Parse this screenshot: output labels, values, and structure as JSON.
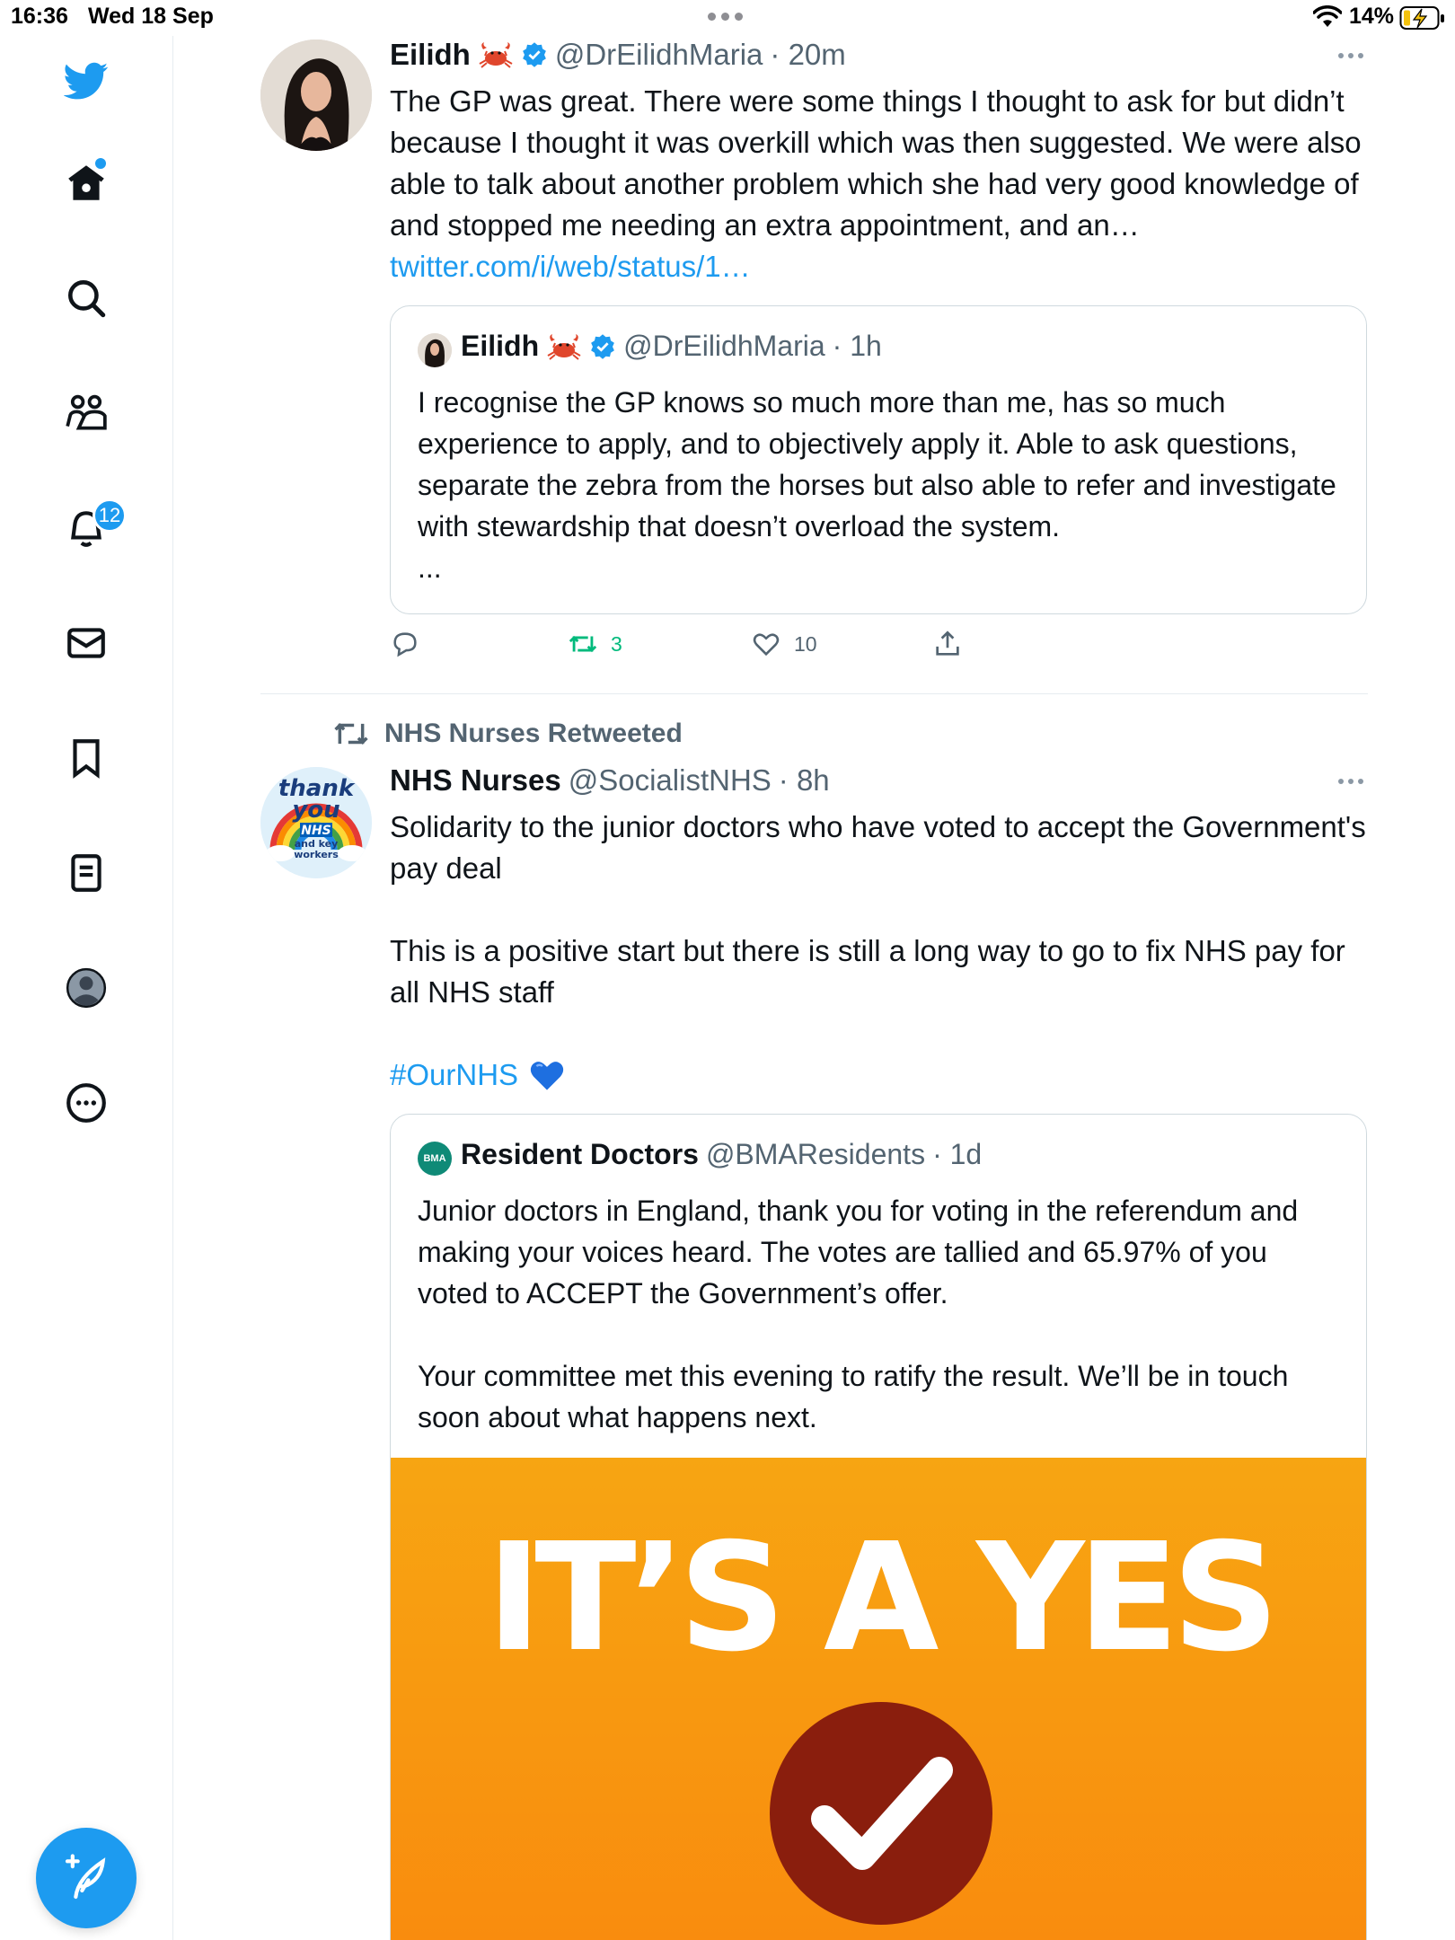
{
  "status_bar": {
    "time": "16:36",
    "date": "Wed 18 Sep",
    "battery_percent": "14%"
  },
  "sidebar": {
    "notification_count": "12",
    "items": [
      "twitter-logo",
      "home",
      "search",
      "communities",
      "notifications",
      "messages",
      "bookmarks",
      "lists",
      "profile",
      "more"
    ]
  },
  "tweet1": {
    "name": "Eilidh",
    "handle": "@DrEilidhMaria",
    "time": "· 20m",
    "text": "The GP was great. There were some things I thought to ask for but didn’t because I thought it was overkill which was then suggested. We were also able to talk about another problem which she had very good knowledge of and stopped me needing an extra appointment, and an…",
    "link": "twitter.com/i/web/status/1…",
    "quote": {
      "name": "Eilidh",
      "handle": "@DrEilidhMaria",
      "time": "· 1h",
      "text": "I recognise the GP knows so much more than me, has so much experience to apply, and to objectively apply it. Able to ask questions, separate the zebra from the horses but also able to refer and investigate with stewardship that doesn’t overload the system.",
      "ellipsis": "..."
    },
    "retweets": "3",
    "likes": "10"
  },
  "tweet2": {
    "retweeted_by": "NHS Nurses Retweeted",
    "name": "NHS Nurses",
    "handle": "@SocialistNHS",
    "time": "· 8h",
    "paragraph1": "Solidarity to the junior doctors who have voted to accept the Government's pay deal",
    "paragraph2": "This is a positive start but there is still a long way to go to fix NHS pay for all NHS staff",
    "hashtag": "#OurNHS",
    "avatar_text": {
      "line1": "thank",
      "line2": "you",
      "line3": "NHS",
      "line4": "and key",
      "line5": "workers"
    },
    "quote": {
      "name": "Resident Doctors",
      "handle": "@BMAResidents",
      "time": "· 1d",
      "avatar_text": "BMA",
      "paragraph1": "Junior doctors in England, thank you for voting in the referendum and making your voices heard. The votes are tallied and 65.97% of you voted to ACCEPT the Government’s offer.",
      "paragraph2": "Your committee met this evening to ratify the result. We’ll be in touch soon about what happens next.",
      "image_text": "IT’S A YES"
    }
  },
  "colors": {
    "accent": "#1d9bf0",
    "retweet_green": "#00ba7c",
    "secondary_text": "#536471",
    "banner_orange": "#f98c0e",
    "check_red": "#8a1e0d"
  }
}
